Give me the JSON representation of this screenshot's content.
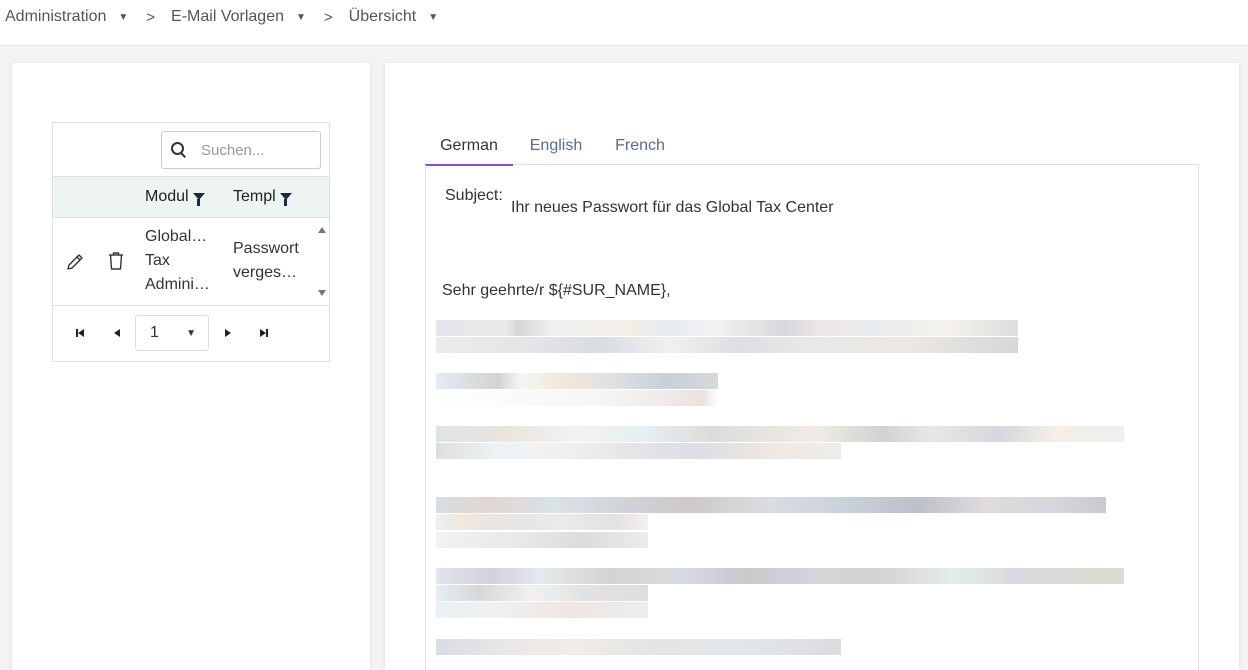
{
  "breadcrumb": {
    "items": [
      "Administration",
      "E-Mail Vorlagen",
      "Übersicht"
    ],
    "separator": ">"
  },
  "grid": {
    "search_placeholder": "Suchen...",
    "columns": [
      "Modul",
      "Templ"
    ],
    "rows": [
      {
        "modul_lines": [
          "GlobalT…",
          "Tax",
          "Adminis…"
        ],
        "templ_lines": [
          "Passwort",
          "vergess…"
        ]
      }
    ],
    "pager": {
      "current_page": "1"
    }
  },
  "editor": {
    "tabs": [
      "German",
      "English",
      "French"
    ],
    "active_tab": "German",
    "subject_label": "Subject:",
    "subject_value": "Ihr neues Passwort für das Global Tax Center",
    "salutation": "Sehr geehrte/r ${#SUR_NAME},"
  },
  "colors": {
    "accent": "#8a4fd8",
    "header_bg": "#eef4f4",
    "filter_icon": "#1a2a44"
  }
}
